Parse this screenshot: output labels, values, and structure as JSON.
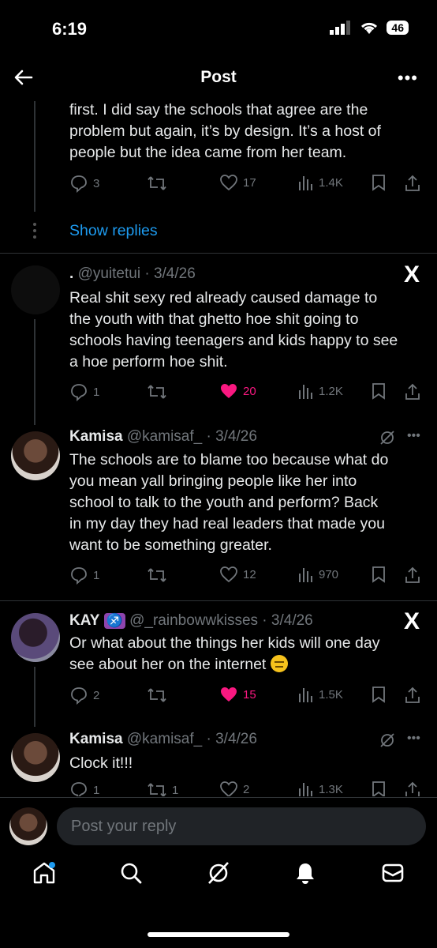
{
  "status": {
    "time": "6:19",
    "battery": "46"
  },
  "header": {
    "title": "Post"
  },
  "post1": {
    "text_lines": [
      "first. I did say the schools that agree are the",
      "problem but again, it’s by design. It’s a host of",
      "people but the idea came from her team."
    ],
    "replies": "3",
    "likes": "17",
    "views": "1.4K"
  },
  "show_replies": "Show replies",
  "post2": {
    "dot": ".",
    "handle": "@yuitetui",
    "date": "· 3/4/26",
    "text_lines": [
      "Real shit sexy red already caused damage to",
      "the youth with that ghetto hoe shit going to",
      "schools having teenagers and kids happy to see",
      "a hoe perform hoe shit."
    ],
    "replies": "1",
    "likes": "20",
    "views": "1.2K"
  },
  "post3": {
    "name": "Kamisa",
    "handle": "@kamisaf_",
    "date": "· 3/4/26",
    "text_lines": [
      "The schools are to blame too because what do",
      "you mean yall bringing people like her into",
      "school to talk to the youth and perform? Back",
      "in my day they had real leaders that made you",
      "want to be something greater."
    ],
    "replies": "1",
    "likes": "12",
    "views": "970"
  },
  "post4": {
    "name": "KAY",
    "emoji": "♐",
    "handle": "@_rainbowwkisses",
    "date": "· 3/4/26",
    "text_lines": [
      "Or what about the things her kids will one day",
      "see about her on the internet"
    ],
    "replies": "2",
    "likes": "15",
    "views": "1.5K"
  },
  "post5": {
    "name": "Kamisa",
    "handle": "@kamisaf_",
    "date": "· 3/4/26",
    "text": "Clock it!!!",
    "replies": "1",
    "reposts": "1",
    "likes": "2",
    "views": "1.3K"
  },
  "reply_box": {
    "placeholder": "Post your reply"
  },
  "x_logo": "X",
  "colors": {
    "like_pink": "#f91880",
    "link_blue": "#1d9bf0",
    "muted": "#71767b"
  }
}
